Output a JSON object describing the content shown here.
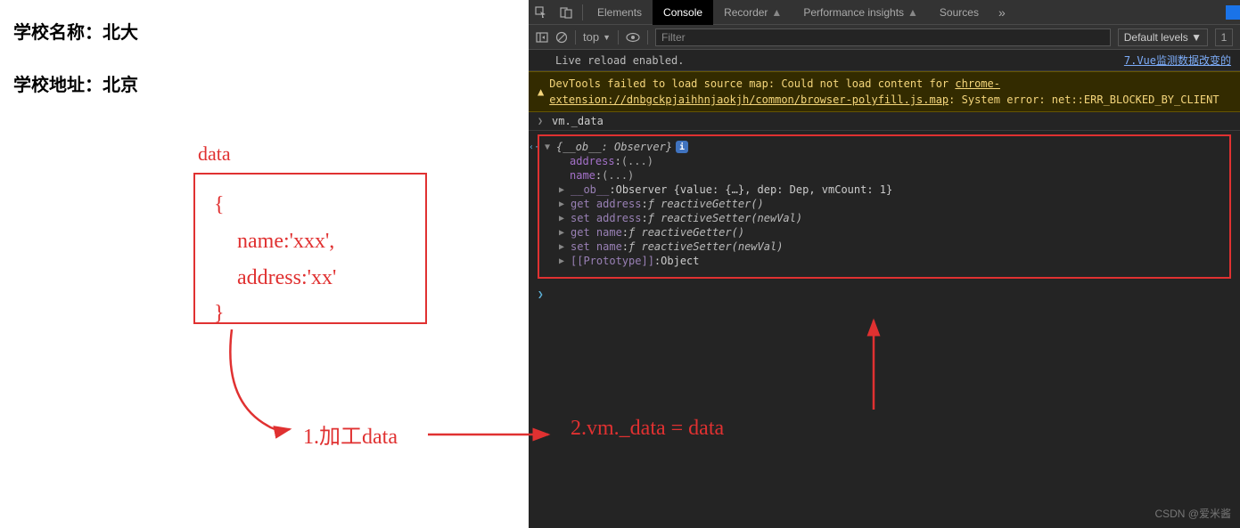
{
  "page": {
    "school_name_label": "学校名称：",
    "school_name_value": "北大",
    "school_addr_label": "学校地址：",
    "school_addr_value": "北京"
  },
  "annotations": {
    "data_label": "data",
    "code_open": "{",
    "code_line1": "name:'xxx',",
    "code_line2": "address:'xx'",
    "code_close": "}",
    "step1": "1.加工data",
    "step2": "2.vm._data = data",
    "watermark": "CSDN @爱米酱"
  },
  "devtools": {
    "tabs": {
      "elements": "Elements",
      "console": "Console",
      "recorder": "Recorder",
      "perf": "Performance insights",
      "sources": "Sources"
    },
    "toolbar": {
      "top": "top",
      "top_arrow": "▼",
      "filter_placeholder": "Filter",
      "levels": "Default levels ▼",
      "count": "1"
    },
    "live_reload": "Live reload enabled.",
    "live_link": "7.Vue监测数据改变的",
    "warning_prefix": "DevTools failed to load source map: Could not load content for ",
    "warning_url": "chrome-extension://dnbgckpjaihhnjaokjh/common/browser-polyfill.js.map",
    "warning_suffix": ": System error: net::ERR_BLOCKED_BY_CLIENT",
    "input_expr": "vm._data",
    "tree": {
      "root_open": "{__ob__: Observer}",
      "address": "address",
      "name": "name",
      "ellipsis": "(...)",
      "ob": "__ob__",
      "ob_val": "Observer {value: {…}, dep: Dep, vmCount: 1}",
      "get_address": "get address",
      "set_address": "set address",
      "get_name": "get name",
      "set_name": "set name",
      "reactive_getter": "ƒ reactiveGetter()",
      "reactive_setter": "ƒ reactiveSetter(newVal)",
      "proto": "[[Prototype]]",
      "object": "Object"
    }
  }
}
